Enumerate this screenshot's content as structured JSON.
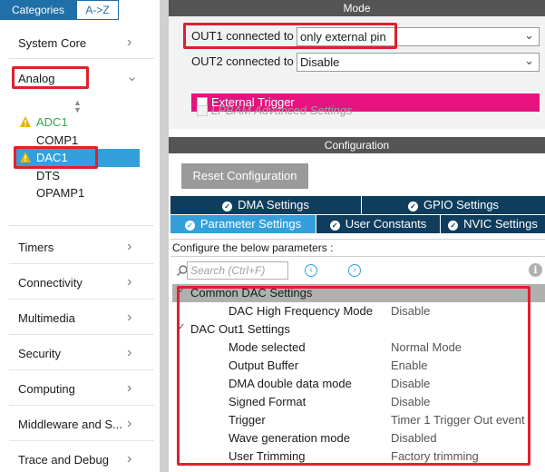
{
  "left_panel": {
    "tabs": {
      "categories": "Categories",
      "az": "A->Z"
    },
    "categories": {
      "system_core": "System Core",
      "analog": "Analog",
      "timers": "Timers",
      "connectivity": "Connectivity",
      "multimedia": "Multimedia",
      "security": "Security",
      "computing": "Computing",
      "middleware": "Middleware and S...",
      "trace": "Trace and Debug"
    },
    "peripherals": {
      "adc1": "ADC1",
      "comp1": "COMP1",
      "dac1": "DAC1",
      "dts": "DTS",
      "opamp1": "OPAMP1"
    }
  },
  "mode": {
    "header": "Mode",
    "out1_label": "OUT1 connected to",
    "out1_value": "only external pin",
    "out2_label": "OUT2 connected to",
    "out2_value": "Disable",
    "external_trigger": "External Trigger",
    "lpbam": "LPBAM Advanced Settings"
  },
  "configuration": {
    "header": "Configuration",
    "reset_button": "Reset Configuration",
    "tabs": {
      "dma": "DMA Settings",
      "gpio": "GPIO Settings",
      "parameter": "Parameter Settings",
      "user_constants": "User Constants",
      "nvic": "NVIC Settings"
    },
    "caption": "Configure the below parameters :",
    "search_placeholder": "Search (Ctrl+F)",
    "params": {
      "common_group": "Common DAC Settings",
      "high_freq_name": "DAC High Frequency Mode",
      "high_freq_value": "Disable",
      "out1_group": "DAC Out1 Settings",
      "mode_name": "Mode selected",
      "mode_value": "Normal Mode",
      "buffer_name": "Output Buffer",
      "buffer_value": "Enable",
      "double_name": "DMA double data mode",
      "double_value": "Disable",
      "signed_name": "Signed Format",
      "signed_value": "Disable",
      "trigger_name": "Trigger",
      "trigger_value": "Timer 1 Trigger Out event",
      "wave_name": "Wave generation mode",
      "wave_value": "Disabled",
      "trim_name": "User Trimming",
      "trim_value": "Factory trimming"
    }
  },
  "colors": {
    "accent": "#34a0db",
    "dark_tab": "#0f3d5e",
    "trigger": "#e6137f",
    "highlight_box": "#e0202e",
    "warning": "#e8b400"
  }
}
